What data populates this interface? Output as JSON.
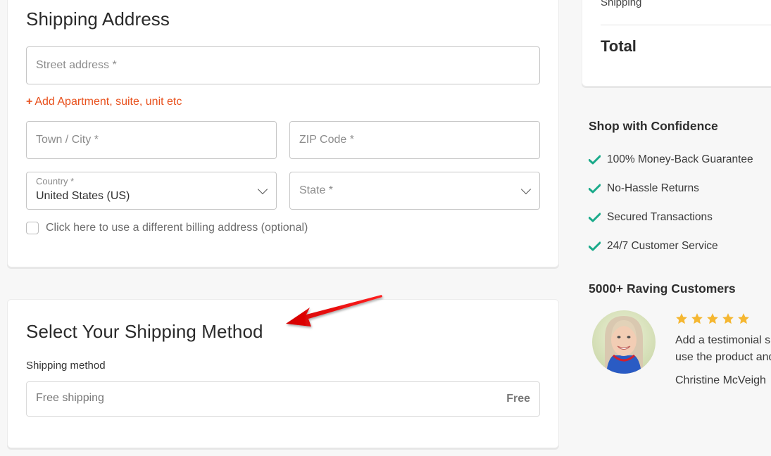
{
  "shipping_address": {
    "title": "Shipping Address",
    "street_placeholder": "Street address *",
    "add_apartment_label": "Add Apartment, suite, unit etc",
    "add_apartment_icon": "+",
    "city_placeholder": "Town / City *",
    "zip_placeholder": "ZIP Code *",
    "country_label": "Country *",
    "country_value": "United States (US)",
    "state_placeholder": "State *",
    "billing_checkbox_label": "Click here to use a different billing address (optional)",
    "billing_checked": false
  },
  "shipping_method": {
    "title": "Select Your Shipping Method",
    "field_label": "Shipping method",
    "option_name": "Free shipping",
    "option_price": "Free"
  },
  "order_summary": {
    "shipping_label": "Shipping",
    "total_label": "Total"
  },
  "confidence": {
    "title": "Shop with Confidence",
    "items": [
      "100% Money-Back Guarantee",
      "No-Hassle Returns",
      "Secured Transactions",
      "24/7 Customer Service"
    ],
    "check_color": "#1aaa8a"
  },
  "customers": {
    "title": "5000+ Raving Customers",
    "rating": 5,
    "rating_max": 5,
    "star_color": "#f5b731",
    "testimonial_lines": [
      "Add a testimonial sh",
      "use the product and"
    ],
    "customer_name": "Christine McVeigh"
  },
  "colors": {
    "accent": "#e8501c",
    "annotation_arrow": "#e01010"
  }
}
